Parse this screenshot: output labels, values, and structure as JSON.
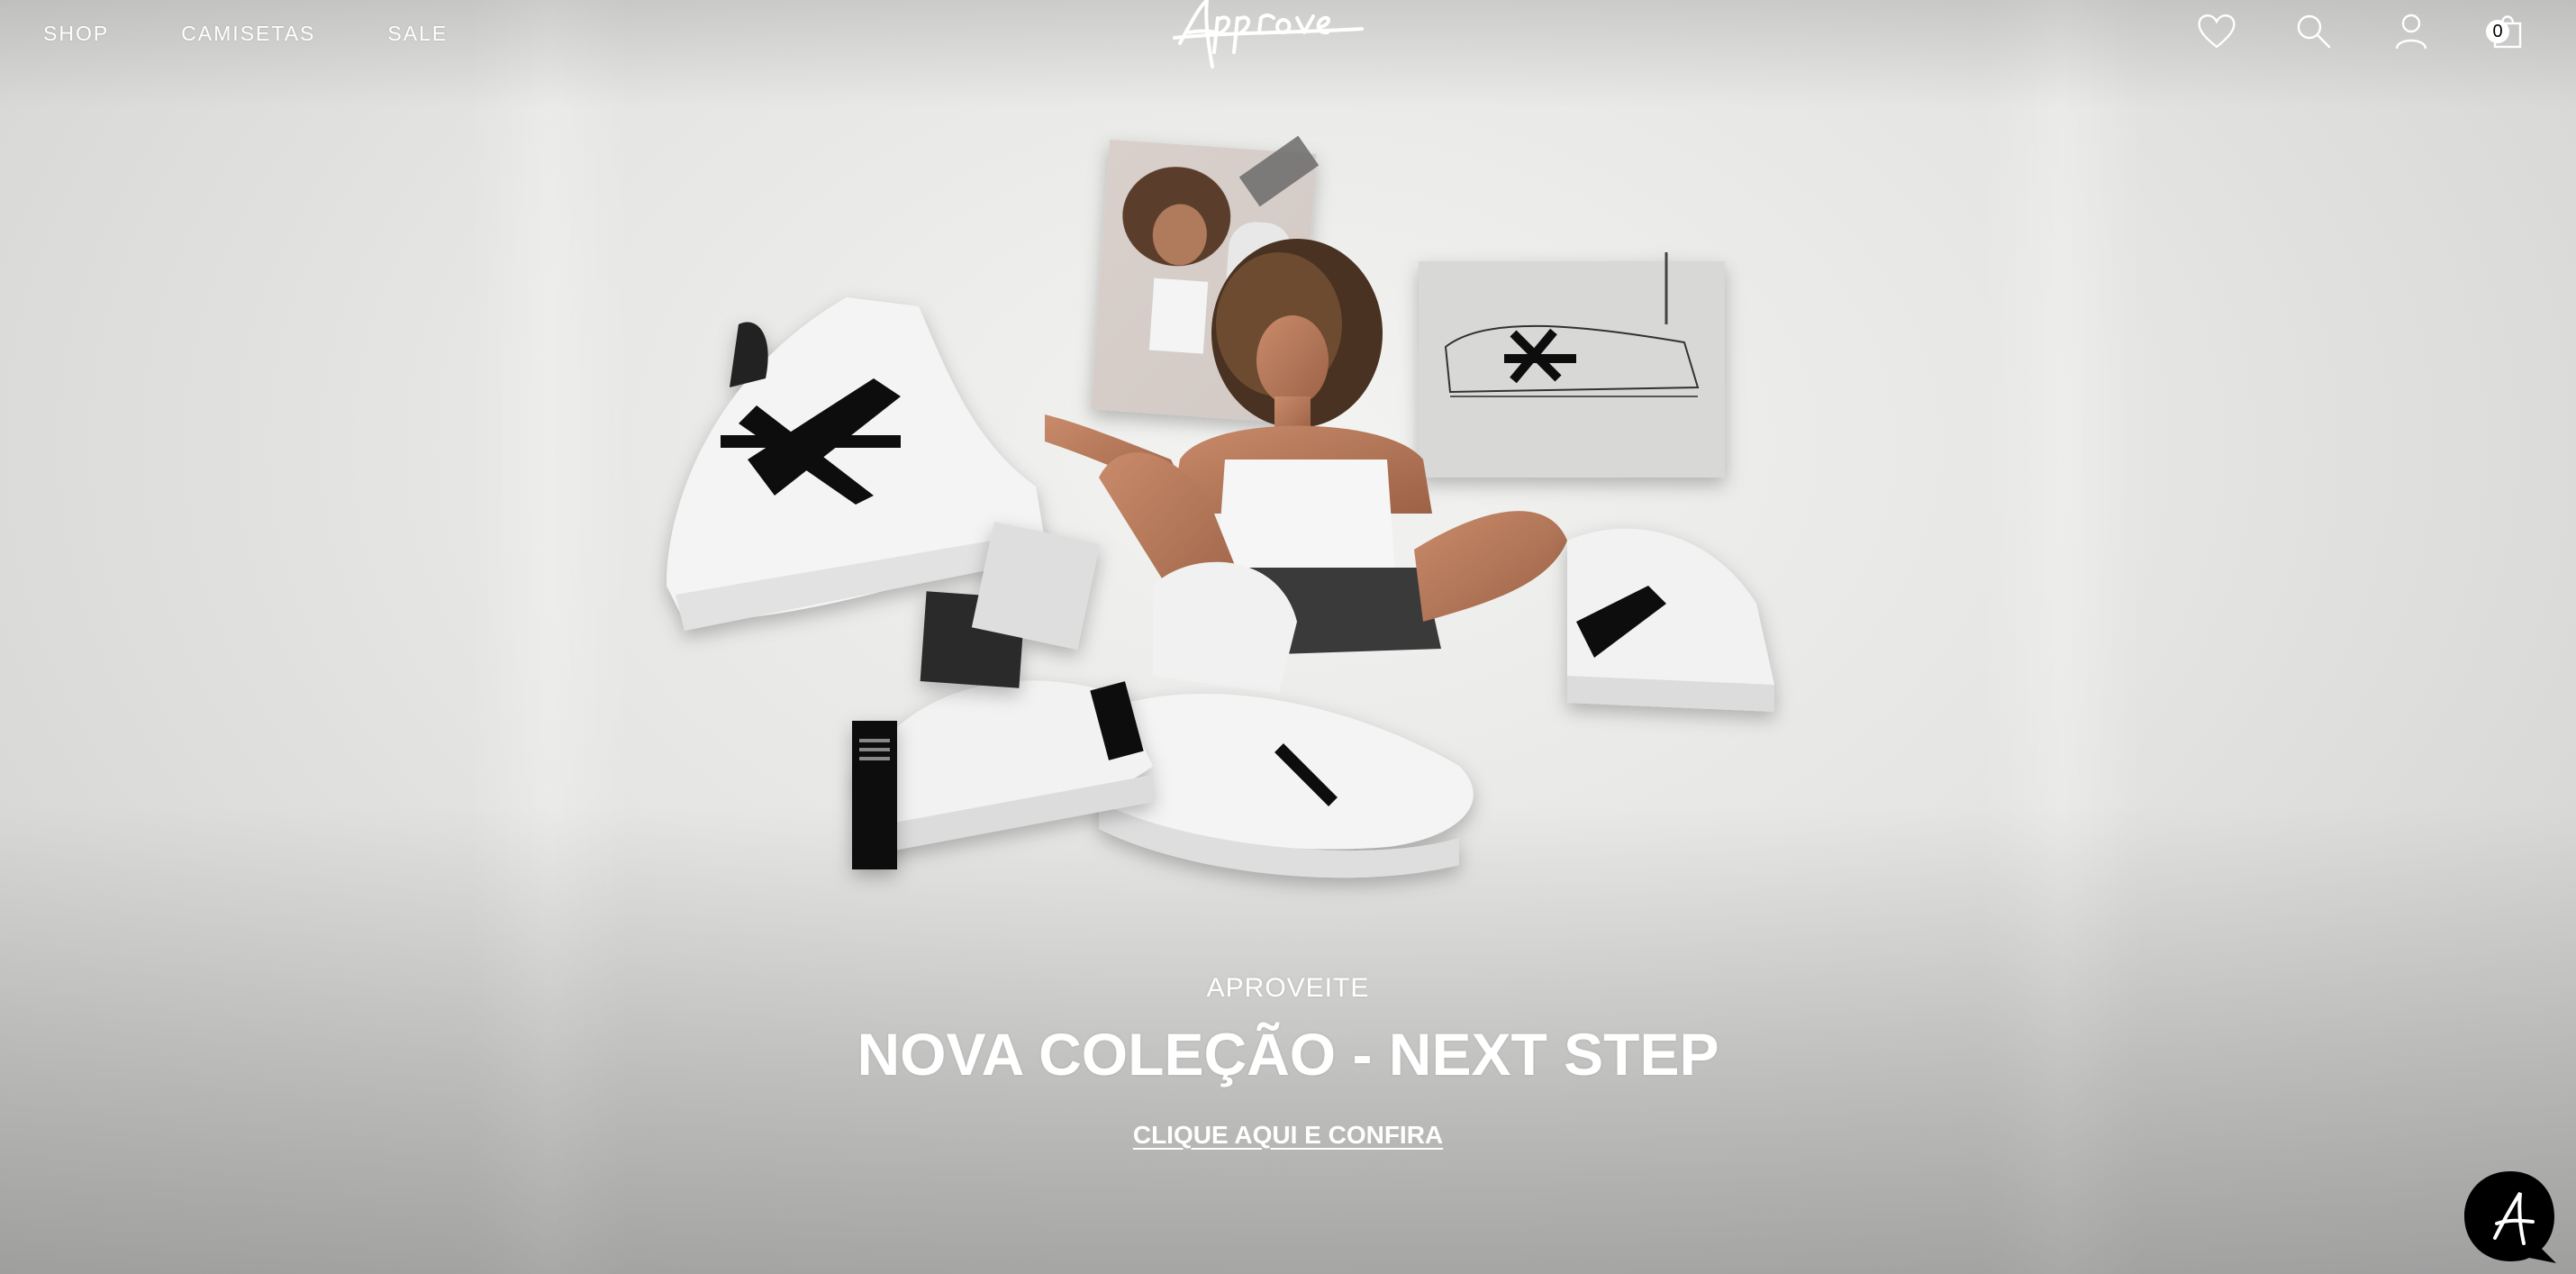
{
  "nav": {
    "items": [
      {
        "label": "SHOP"
      },
      {
        "label": "CAMISETAS"
      },
      {
        "label": "SALE"
      }
    ]
  },
  "brand": {
    "logo_text": "Approve"
  },
  "header_icons": {
    "wishlist": "heart-icon",
    "search": "search-icon",
    "account": "user-icon",
    "cart": "shopping-bag-icon",
    "cart_count": "0"
  },
  "hero": {
    "eyebrow": "APROVEITE",
    "headline": "NOVA COLEÇÃO - NEXT STEP",
    "cta": "CLIQUE AQUI E CONFIRA"
  },
  "chat": {
    "icon": "chat-bubble-icon",
    "glyph": "A"
  },
  "colors": {
    "text_on_hero": "#ffffff",
    "background": "#e6e6e4",
    "chat_bubble": "#000000"
  }
}
